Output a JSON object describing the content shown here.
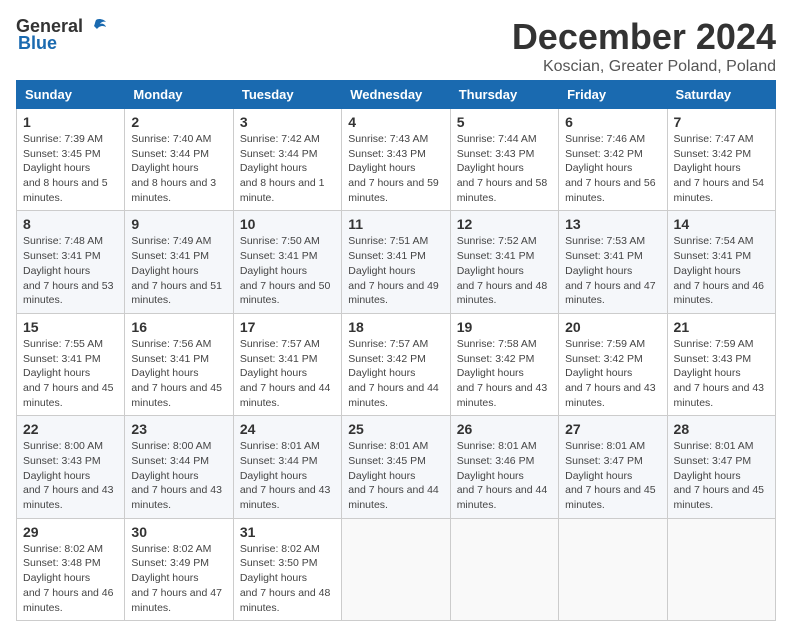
{
  "header": {
    "logo_general": "General",
    "logo_blue": "Blue",
    "title": "December 2024",
    "location": "Koscian, Greater Poland, Poland"
  },
  "weekdays": [
    "Sunday",
    "Monday",
    "Tuesday",
    "Wednesday",
    "Thursday",
    "Friday",
    "Saturday"
  ],
  "weeks": [
    [
      {
        "day": "1",
        "sunrise": "7:39 AM",
        "sunset": "3:45 PM",
        "daylight": "8 hours and 5 minutes."
      },
      {
        "day": "2",
        "sunrise": "7:40 AM",
        "sunset": "3:44 PM",
        "daylight": "8 hours and 3 minutes."
      },
      {
        "day": "3",
        "sunrise": "7:42 AM",
        "sunset": "3:44 PM",
        "daylight": "8 hours and 1 minute."
      },
      {
        "day": "4",
        "sunrise": "7:43 AM",
        "sunset": "3:43 PM",
        "daylight": "7 hours and 59 minutes."
      },
      {
        "day": "5",
        "sunrise": "7:44 AM",
        "sunset": "3:43 PM",
        "daylight": "7 hours and 58 minutes."
      },
      {
        "day": "6",
        "sunrise": "7:46 AM",
        "sunset": "3:42 PM",
        "daylight": "7 hours and 56 minutes."
      },
      {
        "day": "7",
        "sunrise": "7:47 AM",
        "sunset": "3:42 PM",
        "daylight": "7 hours and 54 minutes."
      }
    ],
    [
      {
        "day": "8",
        "sunrise": "7:48 AM",
        "sunset": "3:41 PM",
        "daylight": "7 hours and 53 minutes."
      },
      {
        "day": "9",
        "sunrise": "7:49 AM",
        "sunset": "3:41 PM",
        "daylight": "7 hours and 51 minutes."
      },
      {
        "day": "10",
        "sunrise": "7:50 AM",
        "sunset": "3:41 PM",
        "daylight": "7 hours and 50 minutes."
      },
      {
        "day": "11",
        "sunrise": "7:51 AM",
        "sunset": "3:41 PM",
        "daylight": "7 hours and 49 minutes."
      },
      {
        "day": "12",
        "sunrise": "7:52 AM",
        "sunset": "3:41 PM",
        "daylight": "7 hours and 48 minutes."
      },
      {
        "day": "13",
        "sunrise": "7:53 AM",
        "sunset": "3:41 PM",
        "daylight": "7 hours and 47 minutes."
      },
      {
        "day": "14",
        "sunrise": "7:54 AM",
        "sunset": "3:41 PM",
        "daylight": "7 hours and 46 minutes."
      }
    ],
    [
      {
        "day": "15",
        "sunrise": "7:55 AM",
        "sunset": "3:41 PM",
        "daylight": "7 hours and 45 minutes."
      },
      {
        "day": "16",
        "sunrise": "7:56 AM",
        "sunset": "3:41 PM",
        "daylight": "7 hours and 45 minutes."
      },
      {
        "day": "17",
        "sunrise": "7:57 AM",
        "sunset": "3:41 PM",
        "daylight": "7 hours and 44 minutes."
      },
      {
        "day": "18",
        "sunrise": "7:57 AM",
        "sunset": "3:42 PM",
        "daylight": "7 hours and 44 minutes."
      },
      {
        "day": "19",
        "sunrise": "7:58 AM",
        "sunset": "3:42 PM",
        "daylight": "7 hours and 43 minutes."
      },
      {
        "day": "20",
        "sunrise": "7:59 AM",
        "sunset": "3:42 PM",
        "daylight": "7 hours and 43 minutes."
      },
      {
        "day": "21",
        "sunrise": "7:59 AM",
        "sunset": "3:43 PM",
        "daylight": "7 hours and 43 minutes."
      }
    ],
    [
      {
        "day": "22",
        "sunrise": "8:00 AM",
        "sunset": "3:43 PM",
        "daylight": "7 hours and 43 minutes."
      },
      {
        "day": "23",
        "sunrise": "8:00 AM",
        "sunset": "3:44 PM",
        "daylight": "7 hours and 43 minutes."
      },
      {
        "day": "24",
        "sunrise": "8:01 AM",
        "sunset": "3:44 PM",
        "daylight": "7 hours and 43 minutes."
      },
      {
        "day": "25",
        "sunrise": "8:01 AM",
        "sunset": "3:45 PM",
        "daylight": "7 hours and 44 minutes."
      },
      {
        "day": "26",
        "sunrise": "8:01 AM",
        "sunset": "3:46 PM",
        "daylight": "7 hours and 44 minutes."
      },
      {
        "day": "27",
        "sunrise": "8:01 AM",
        "sunset": "3:47 PM",
        "daylight": "7 hours and 45 minutes."
      },
      {
        "day": "28",
        "sunrise": "8:01 AM",
        "sunset": "3:47 PM",
        "daylight": "7 hours and 45 minutes."
      }
    ],
    [
      {
        "day": "29",
        "sunrise": "8:02 AM",
        "sunset": "3:48 PM",
        "daylight": "7 hours and 46 minutes."
      },
      {
        "day": "30",
        "sunrise": "8:02 AM",
        "sunset": "3:49 PM",
        "daylight": "7 hours and 47 minutes."
      },
      {
        "day": "31",
        "sunrise": "8:02 AM",
        "sunset": "3:50 PM",
        "daylight": "7 hours and 48 minutes."
      },
      null,
      null,
      null,
      null
    ]
  ]
}
